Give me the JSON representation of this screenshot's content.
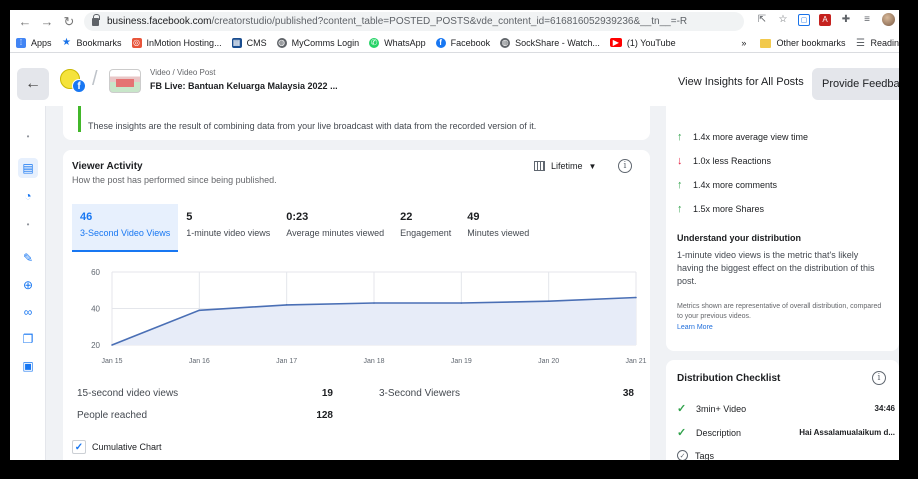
{
  "browser": {
    "url_host": "business.facebook.com",
    "url_path": "/creatorstudio/published?content_table=POSTED_POSTS&vde_content_id=616816052939236&__tn__=-R",
    "bookmarks": [
      {
        "label": "Apps",
        "icon": "apps-grid-icon",
        "color": "#4285f4"
      },
      {
        "label": "Bookmarks",
        "icon": "star-icon",
        "color": "#1a73e8"
      },
      {
        "label": "InMotion Hosting...",
        "icon": "inmotion-icon",
        "color": "#e8543a"
      },
      {
        "label": "CMS",
        "icon": "cms-grid-icon",
        "color": "#1a4d8f"
      },
      {
        "label": "MyComms Login",
        "icon": "globe-icon",
        "color": "#5f6368"
      },
      {
        "label": "WhatsApp",
        "icon": "whatsapp-icon",
        "color": "#25d366"
      },
      {
        "label": "Facebook",
        "icon": "facebook-icon",
        "color": "#1877f2"
      },
      {
        "label": "SockShare - Watch...",
        "icon": "globe-icon",
        "color": "#5f6368"
      },
      {
        "label": "(1) YouTube",
        "icon": "youtube-icon",
        "color": "#ff0000"
      }
    ],
    "overflow": "»",
    "other_bookmarks": "Other bookmarks",
    "reading_list": "Readin"
  },
  "header": {
    "breadcrumb": "Video / Video Post",
    "post_title": "FB Live: Bantuan Keluarga Malaysia 2022 ...",
    "view_insights": "View Insights for All Posts",
    "feedback": "Provide Feedback"
  },
  "note": {
    "text": "These insights are the result of combining data from your live broadcast with data from the recorded version of it."
  },
  "viewer_activity": {
    "title": "Viewer Activity",
    "subtitle": "How the post has performed since being published.",
    "range": "Lifetime",
    "metrics": [
      {
        "value": "46",
        "label": "3-Second Video Views"
      },
      {
        "value": "5",
        "label": "1-minute video views"
      },
      {
        "value": "0:23",
        "label": "Average minutes viewed"
      },
      {
        "value": "22",
        "label": "Engagement"
      },
      {
        "value": "49",
        "label": "Minutes viewed"
      }
    ],
    "stats": {
      "fifteen_label": "15-second video views",
      "fifteen_value": "19",
      "viewers_label": "3-Second Viewers",
      "viewers_value": "38",
      "reached_label": "People reached",
      "reached_value": "128"
    },
    "cumulative_label": "Cumulative Chart",
    "cumulative_checked": "✓"
  },
  "chart_data": {
    "type": "area",
    "x": [
      "Jan 15",
      "Jan 16",
      "Jan 17",
      "Jan 18",
      "Jan 19",
      "Jan 20",
      "Jan 21"
    ],
    "series": [
      {
        "values": [
          20,
          39,
          42,
          43,
          43,
          44,
          46
        ]
      }
    ],
    "yticks": [
      20,
      40,
      60
    ],
    "ylim": [
      20,
      60
    ],
    "grid": true,
    "line_color": "#4a6fb5",
    "fill_color": "#e7ecf8"
  },
  "comparison": {
    "items": [
      {
        "arrow": "↑",
        "dir": "up",
        "text": "1.4x more average view time"
      },
      {
        "arrow": "↓",
        "dir": "down",
        "text": "1.0x less Reactions"
      },
      {
        "arrow": "↑",
        "dir": "up",
        "text": "1.4x more comments"
      },
      {
        "arrow": "↑",
        "dir": "up",
        "text": "1.5x more Shares"
      }
    ],
    "dist_title": "Understand your distribution",
    "dist_text": "1-minute video views is the metric that's likely having the biggest effect on the distribution of this post.",
    "metrics_note": "Metrics shown are representative of overall distribution, compared to your previous videos.",
    "learn_more": "Learn More"
  },
  "checklist": {
    "title": "Distribution Checklist",
    "items": [
      {
        "label": "3min+ Video",
        "value": "34:46",
        "status": "done"
      },
      {
        "label": "Description",
        "value": "Hai Assalamualaikum d...",
        "status": "done"
      },
      {
        "label": "Tags",
        "value": "",
        "status": "pending"
      }
    ]
  },
  "colors": {
    "accent": "#1877f2",
    "positive": "#31a24c",
    "negative": "#e41e3f"
  }
}
